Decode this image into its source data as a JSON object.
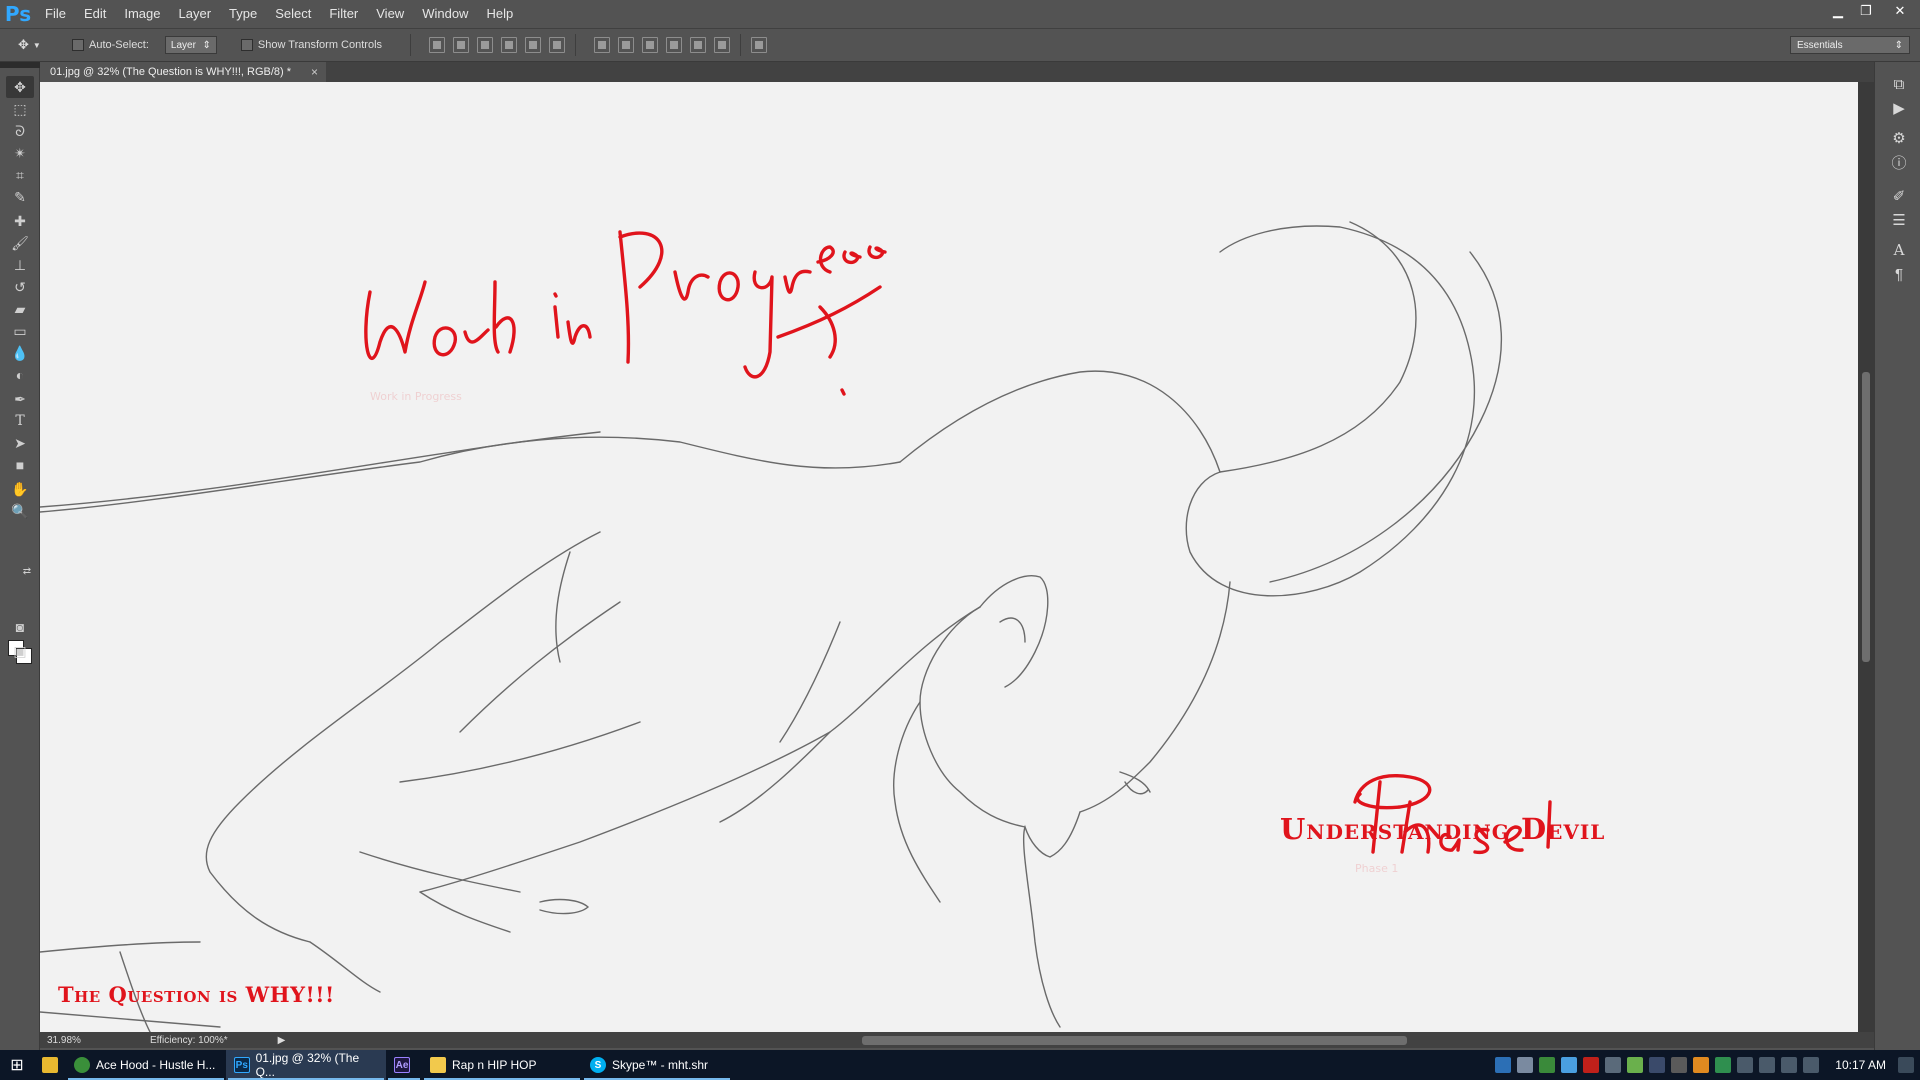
{
  "app": {
    "logo": "Ps"
  },
  "menu": [
    "File",
    "Edit",
    "Image",
    "Layer",
    "Type",
    "Select",
    "Filter",
    "View",
    "Window",
    "Help"
  ],
  "window_controls": {
    "minimize": "▁",
    "restore": "❐",
    "close": "✕"
  },
  "options": {
    "auto_select_label": "Auto-Select:",
    "auto_select_target": "Layer",
    "show_transform_label": "Show Transform Controls",
    "workspace": "Essentials"
  },
  "document": {
    "tab_title": "01.jpg @ 32% (The Question is WHY!!!, RGB/8) *",
    "close_glyph": "×"
  },
  "canvas_text": {
    "work_in_progress": "Work in Progress",
    "phase": "Phase 1",
    "understanding": "Understanding Devil",
    "question": "The Question is WHY!!!"
  },
  "status": {
    "zoom": "31.98%",
    "efficiency": "Efficiency: 100%*"
  },
  "taskbar": {
    "items": [
      {
        "label": "Ace Hood - Hustle H...",
        "icon": "chrome-icon"
      },
      {
        "label": "01.jpg @ 32% (The Q...",
        "icon": "photoshop-icon"
      },
      {
        "label": "",
        "icon": "after-effects-icon"
      },
      {
        "label": "Rap n HIP HOP",
        "icon": "folder-icon"
      },
      {
        "label": "Skype™ - mht.shr",
        "icon": "skype-icon"
      }
    ],
    "clock": "10:17 AM"
  },
  "colors": {
    "accent_red": "#e0141c",
    "ps_blue": "#31a8ff"
  }
}
